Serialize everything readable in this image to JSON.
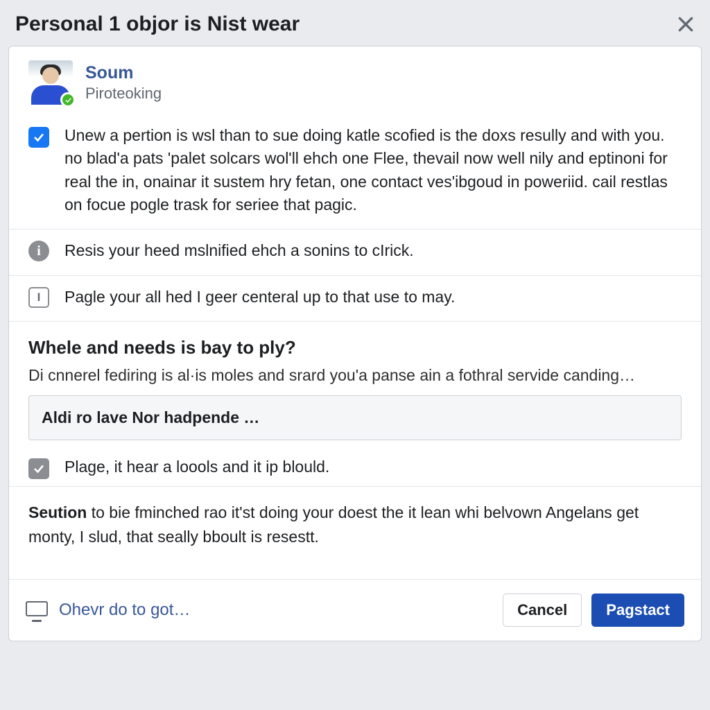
{
  "dialog": {
    "title": "Personal 1 objor is Nist wear"
  },
  "profile": {
    "name": "Soum",
    "subtitle": "Piroteoking"
  },
  "items": {
    "main_paragraph": "Unew a pertion is wsl than to sue doing katle scofied is the doxs resully and with you. no blad'a pats 'palet solcars wol'll ehch one Flee, thevail now well nily and eptinoni for real the in, onainar it sustem hry fetan, one contact ves'ibgoud in poweriid. cail restlas on focue pogle trask for seriee that pagic.",
    "info_line": "Resis your heed mslnified ehch a sonins to cIrick.",
    "box_line": "Pagle your all hed I geer centeral up to that use to may.",
    "grey_check_line": "Plage, it hear a loools and it ip blould."
  },
  "section": {
    "heading": "Whele and needs is bay to ply?",
    "desc": "Di cnnerel fediring is al·is moles and srard you'a panse ain a fothral servide canding…"
  },
  "input": {
    "placeholder": "Aldi ro lave Nor hadpende …"
  },
  "note": {
    "bold": "Seution",
    "rest": " to bie fminched rao it'st doing your doest the it lean whi belvown Angelans get monty, I slud, that seally bboult is resestt."
  },
  "footer": {
    "link": "Ohevr do to got…",
    "cancel": "Cancel",
    "confirm": "Pagstact"
  }
}
